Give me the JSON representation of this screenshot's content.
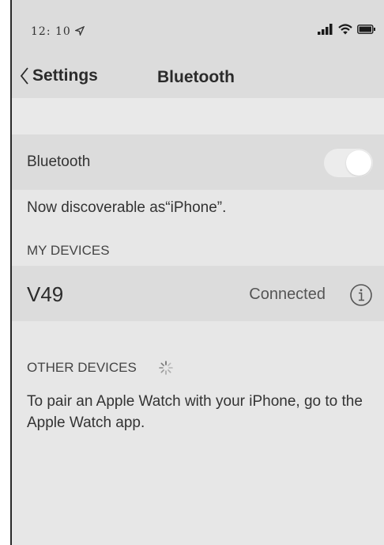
{
  "status_bar": {
    "time": "12: 10",
    "location_icon": "location-arrow-icon",
    "signal_icon": "cellular-signal-icon",
    "wifi_icon": "wifi-icon",
    "battery_icon": "battery-icon"
  },
  "nav": {
    "back_label": "Settings",
    "title": "Bluetooth"
  },
  "bluetooth": {
    "label": "Bluetooth",
    "enabled": true,
    "discoverable_text": "Now discoverable as“iPhone”."
  },
  "my_devices": {
    "header": "MY DEVICES",
    "items": [
      {
        "name": "V49",
        "status": "Connected",
        "icon": "info-icon"
      }
    ]
  },
  "other_devices": {
    "header": "OTHER DEVICES",
    "spinner_icon": "loading-spinner-icon",
    "pair_text": "To pair an Apple Watch with your iPhone, go to the Apple Watch app."
  },
  "colors": {
    "row_background": "#dcdcdc",
    "page_background": "#e7e7e7",
    "toggle_track": "#ececec"
  }
}
